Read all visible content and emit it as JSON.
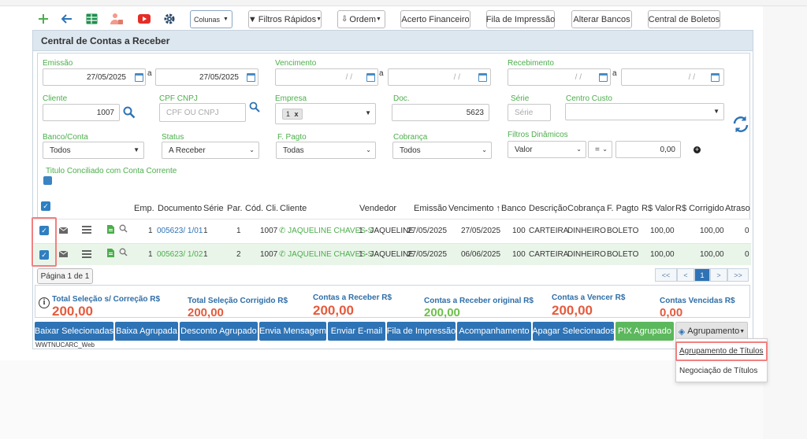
{
  "toolbar": {
    "colunas_label": "Colunas",
    "filtros_label": "Filtros Rápidos",
    "ordem_label": "Ordem",
    "acerto_label": "Acerto Financeiro",
    "fila_label": "Fila de Impressão",
    "alterar_label": "Alterar Bancos",
    "central_boletos_label": "Central de Boletos"
  },
  "panel": {
    "title": "Central de Contas a Receber"
  },
  "filters": {
    "emissao_label": "Emissão",
    "emissao_from": "27/05/2025",
    "emissao_to": "27/05/2025",
    "a_label": "a",
    "vencimento_label": "Vencimento",
    "vencimento_from": "/ /",
    "vencimento_to": "/ /",
    "recebimento_label": "Recebimento",
    "recebimento_from": "/ /",
    "recebimento_to": "/ /",
    "cliente_label": "Cliente",
    "cliente_value": "1007",
    "cpf_label": "CPF CNPJ",
    "cpf_placeholder": "CPF OU CNPJ",
    "empresa_label": "Empresa",
    "empresa_tag": "1",
    "empresa_tag_x": "x",
    "doc_label": "Doc.",
    "doc_value": "5623",
    "serie_label": "Série",
    "serie_placeholder": "Série",
    "centro_custo_label": "Centro Custo",
    "banco_label": "Banco/Conta",
    "banco_value": "Todos",
    "status_label": "Status",
    "status_value": "A Receber",
    "fpagto_label": "F. Pagto",
    "fpagto_value": "Todas",
    "cobranca_label": "Cobrança",
    "cobranca_value": "Todos",
    "filtros_din_label": "Filtros Dinâmicos",
    "filtros_din_field": "Valor",
    "filtros_din_op": "=",
    "filtros_din_value": "0,00",
    "titulo_conciliado_label": "Titulo Conciliado com Conta Corrente"
  },
  "table": {
    "headers": [
      "Emp.",
      "Documento",
      "Série",
      "Par.",
      "Cód. Cli.",
      "Cliente",
      "Vendedor",
      "Emissão",
      "Vencimento",
      "Banco",
      "Descrição",
      "Cobrança",
      "F. Pagto",
      "R$ Valor",
      "R$ Corrigido",
      "Atraso"
    ],
    "rows": [
      {
        "emp": "1",
        "documento": "005623/ 1/01",
        "serie": "1",
        "par": "1",
        "cod_cli": "1007",
        "cliente": "JAQUELINE CHAVES S",
        "vendedor": "1 - JAQUELINE",
        "emissao": "27/05/2025",
        "vencimento": "27/05/2025",
        "banco": "100",
        "descricao": "CARTEIRA",
        "cobranca": "DINHEIRO",
        "fpagto": "BOLETO",
        "valor": "100,00",
        "corrigido": "100,00",
        "atraso": "0"
      },
      {
        "emp": "1",
        "documento": "005623/ 1/02",
        "serie": "1",
        "par": "2",
        "cod_cli": "1007",
        "cliente": "JAQUELINE CHAVES S",
        "vendedor": "1 - JAQUELINE",
        "emissao": "27/05/2025",
        "vencimento": "06/06/2025",
        "banco": "100",
        "descricao": "CARTEIRA",
        "cobranca": "DINHEIRO",
        "fpagto": "BOLETO",
        "valor": "100,00",
        "corrigido": "100,00",
        "atraso": "0"
      }
    ],
    "page_label": "Página 1 de 1",
    "pager": [
      "<<",
      "<",
      "1",
      ">",
      ">>"
    ]
  },
  "totals": [
    {
      "label": "Total Seleção s/ Correção R$",
      "value": "200,00"
    },
    {
      "label": "Total Seleção Corrigido R$",
      "value": "200,00"
    },
    {
      "label": "Contas a Receber R$",
      "value": "200,00"
    },
    {
      "label": "Contas a Receber original R$",
      "value": "200,00"
    },
    {
      "label": "Contas a Vencer R$",
      "value": "200,00"
    },
    {
      "label": "Contas Vencidas R$",
      "value": "0,00"
    }
  ],
  "actions": {
    "baixar": "Baixar Selecionadas",
    "baixa_agrupada": "Baixa Agrupada",
    "desconto": "Desconto Agrupado",
    "envia_msg": "Envia Mensagem",
    "enviar_email": "Enviar E-mail",
    "fila": "Fila de Impressão",
    "acompanhamento": "Acompanhamento",
    "apagar": "Apagar Selecionados",
    "pix": "PIX Agrupado",
    "agrupamento": "Agrupamento"
  },
  "dropdown": {
    "item1": "Agrupamento de Títulos",
    "item2": "Negociação de Títulos"
  },
  "footer": {
    "code": "WWTNUCARC_Web"
  },
  "colors": {
    "primary": "#2e73b5",
    "green": "#5cb85c",
    "accent_red": "#e55b3c",
    "highlight": "#f08080"
  }
}
